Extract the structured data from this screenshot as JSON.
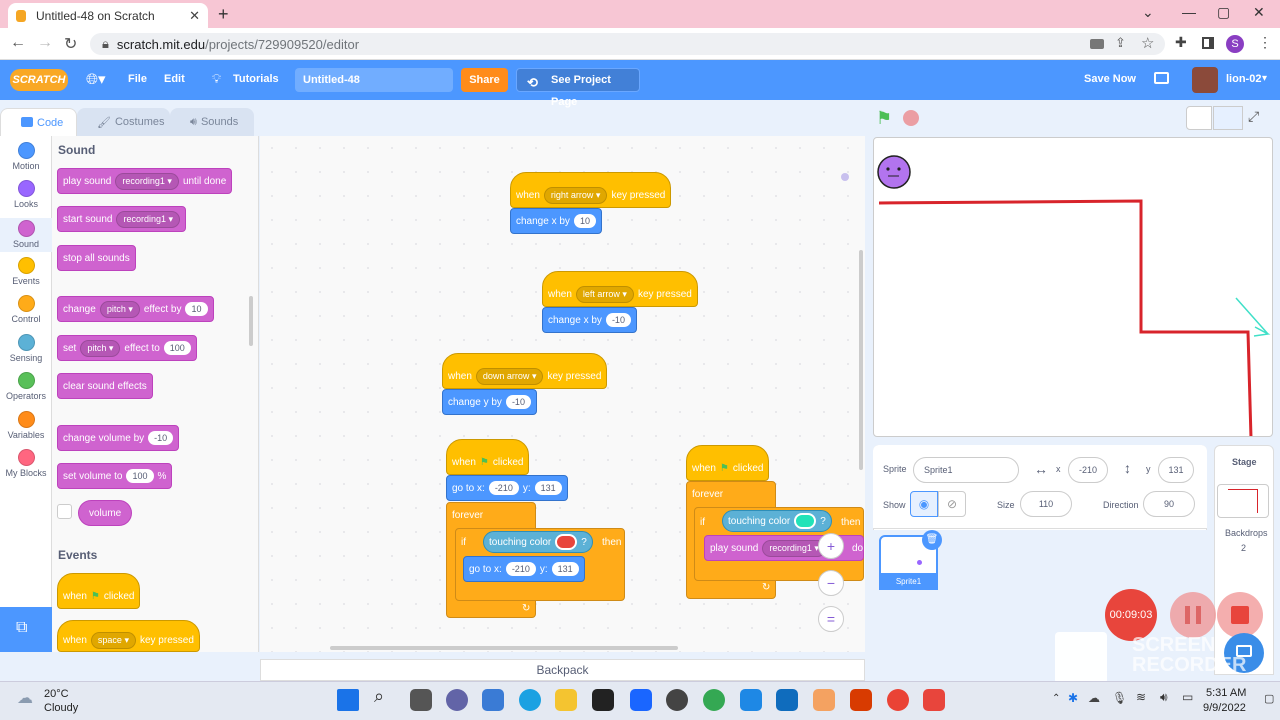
{
  "browser": {
    "tab_title": "Untitled-48 on Scratch",
    "new_tab": "+",
    "url_domain": "scratch.mit.edu",
    "url_path": "/projects/729909520/editor",
    "profile_initial": "S"
  },
  "menubar": {
    "logo": "SCRATCH",
    "file": "File",
    "edit": "Edit",
    "tutorials": "Tutorials",
    "project_title": "Untitled-48",
    "share": "Share",
    "see_project": "See Project Page",
    "save_now": "Save Now",
    "username": "lion-02"
  },
  "tabs": {
    "code": "Code",
    "costumes": "Costumes",
    "sounds": "Sounds"
  },
  "categories": [
    {
      "label": "Motion",
      "color": "#4c97ff"
    },
    {
      "label": "Looks",
      "color": "#9966ff"
    },
    {
      "label": "Sound",
      "color": "#cf63cf"
    },
    {
      "label": "Events",
      "color": "#ffbf00"
    },
    {
      "label": "Control",
      "color": "#ffab19"
    },
    {
      "label": "Sensing",
      "color": "#5cb1d6"
    },
    {
      "label": "Operators",
      "color": "#59c059"
    },
    {
      "label": "Variables",
      "color": "#ff8c1a"
    },
    {
      "label": "My Blocks",
      "color": "#ff6680"
    }
  ],
  "palette": {
    "sound_header": "Sound",
    "play_sound": "play sound",
    "recording1": "recording1",
    "until_done": "until done",
    "start_sound": "start sound",
    "stop_all": "stop all sounds",
    "change": "change",
    "pitch": "pitch",
    "effect_by": "effect by",
    "val_10": "10",
    "set": "set",
    "effect_to": "effect to",
    "val_100": "100",
    "clear_effects": "clear sound effects",
    "change_volume_by": "change volume by",
    "val_neg10": "-10",
    "set_volume_to": "set volume to",
    "percent": "%",
    "volume": "volume",
    "events_header": "Events",
    "when": "when",
    "clicked": "clicked",
    "space": "space",
    "key_pressed": "key pressed"
  },
  "scripts": {
    "when": "when",
    "right_arrow": "right arrow",
    "left_arrow": "left arrow",
    "down_arrow": "down arrow",
    "key_pressed": "key pressed",
    "change_x_by": "change x by",
    "change_y_by": "change y by",
    "x_plus": "10",
    "x_minus": "-10",
    "y_minus": "-10",
    "clicked": "clicked",
    "go_to_x": "go to x:",
    "y_label": "y:",
    "x_val": "-210",
    "y_val": "131",
    "forever": "forever",
    "if": "if",
    "touching_color": "touching color",
    "q": "?",
    "then": "then",
    "play_sound": "play sound",
    "recording1": "recording1",
    "done": "done",
    "red_color": "#e8453c",
    "teal_color": "#22e3b8",
    "zoom_in": "+",
    "zoom_out": "−",
    "zoom_reset": "="
  },
  "backpack": "Backpack",
  "sprite_info": {
    "sprite_label": "Sprite",
    "sprite_name": "Sprite1",
    "x_label": "x",
    "x_value": "-210",
    "y_label": "y",
    "y_value": "131",
    "show_label": "Show",
    "size_label": "Size",
    "size_value": "110",
    "direction_label": "Direction",
    "direction_value": "90",
    "thumb_name": "Sprite1"
  },
  "stage_pane": {
    "title": "Stage",
    "backdrops_label": "Backdrops",
    "backdrops_count": "2"
  },
  "recorder": {
    "time": "00:09:03",
    "watermark_line1": "SCREEN",
    "watermark_line2": "RECORDER"
  },
  "taskbar": {
    "weather_temp": "20°C",
    "weather_desc": "Cloudy",
    "time": "5:31 AM",
    "date": "9/9/2022"
  }
}
